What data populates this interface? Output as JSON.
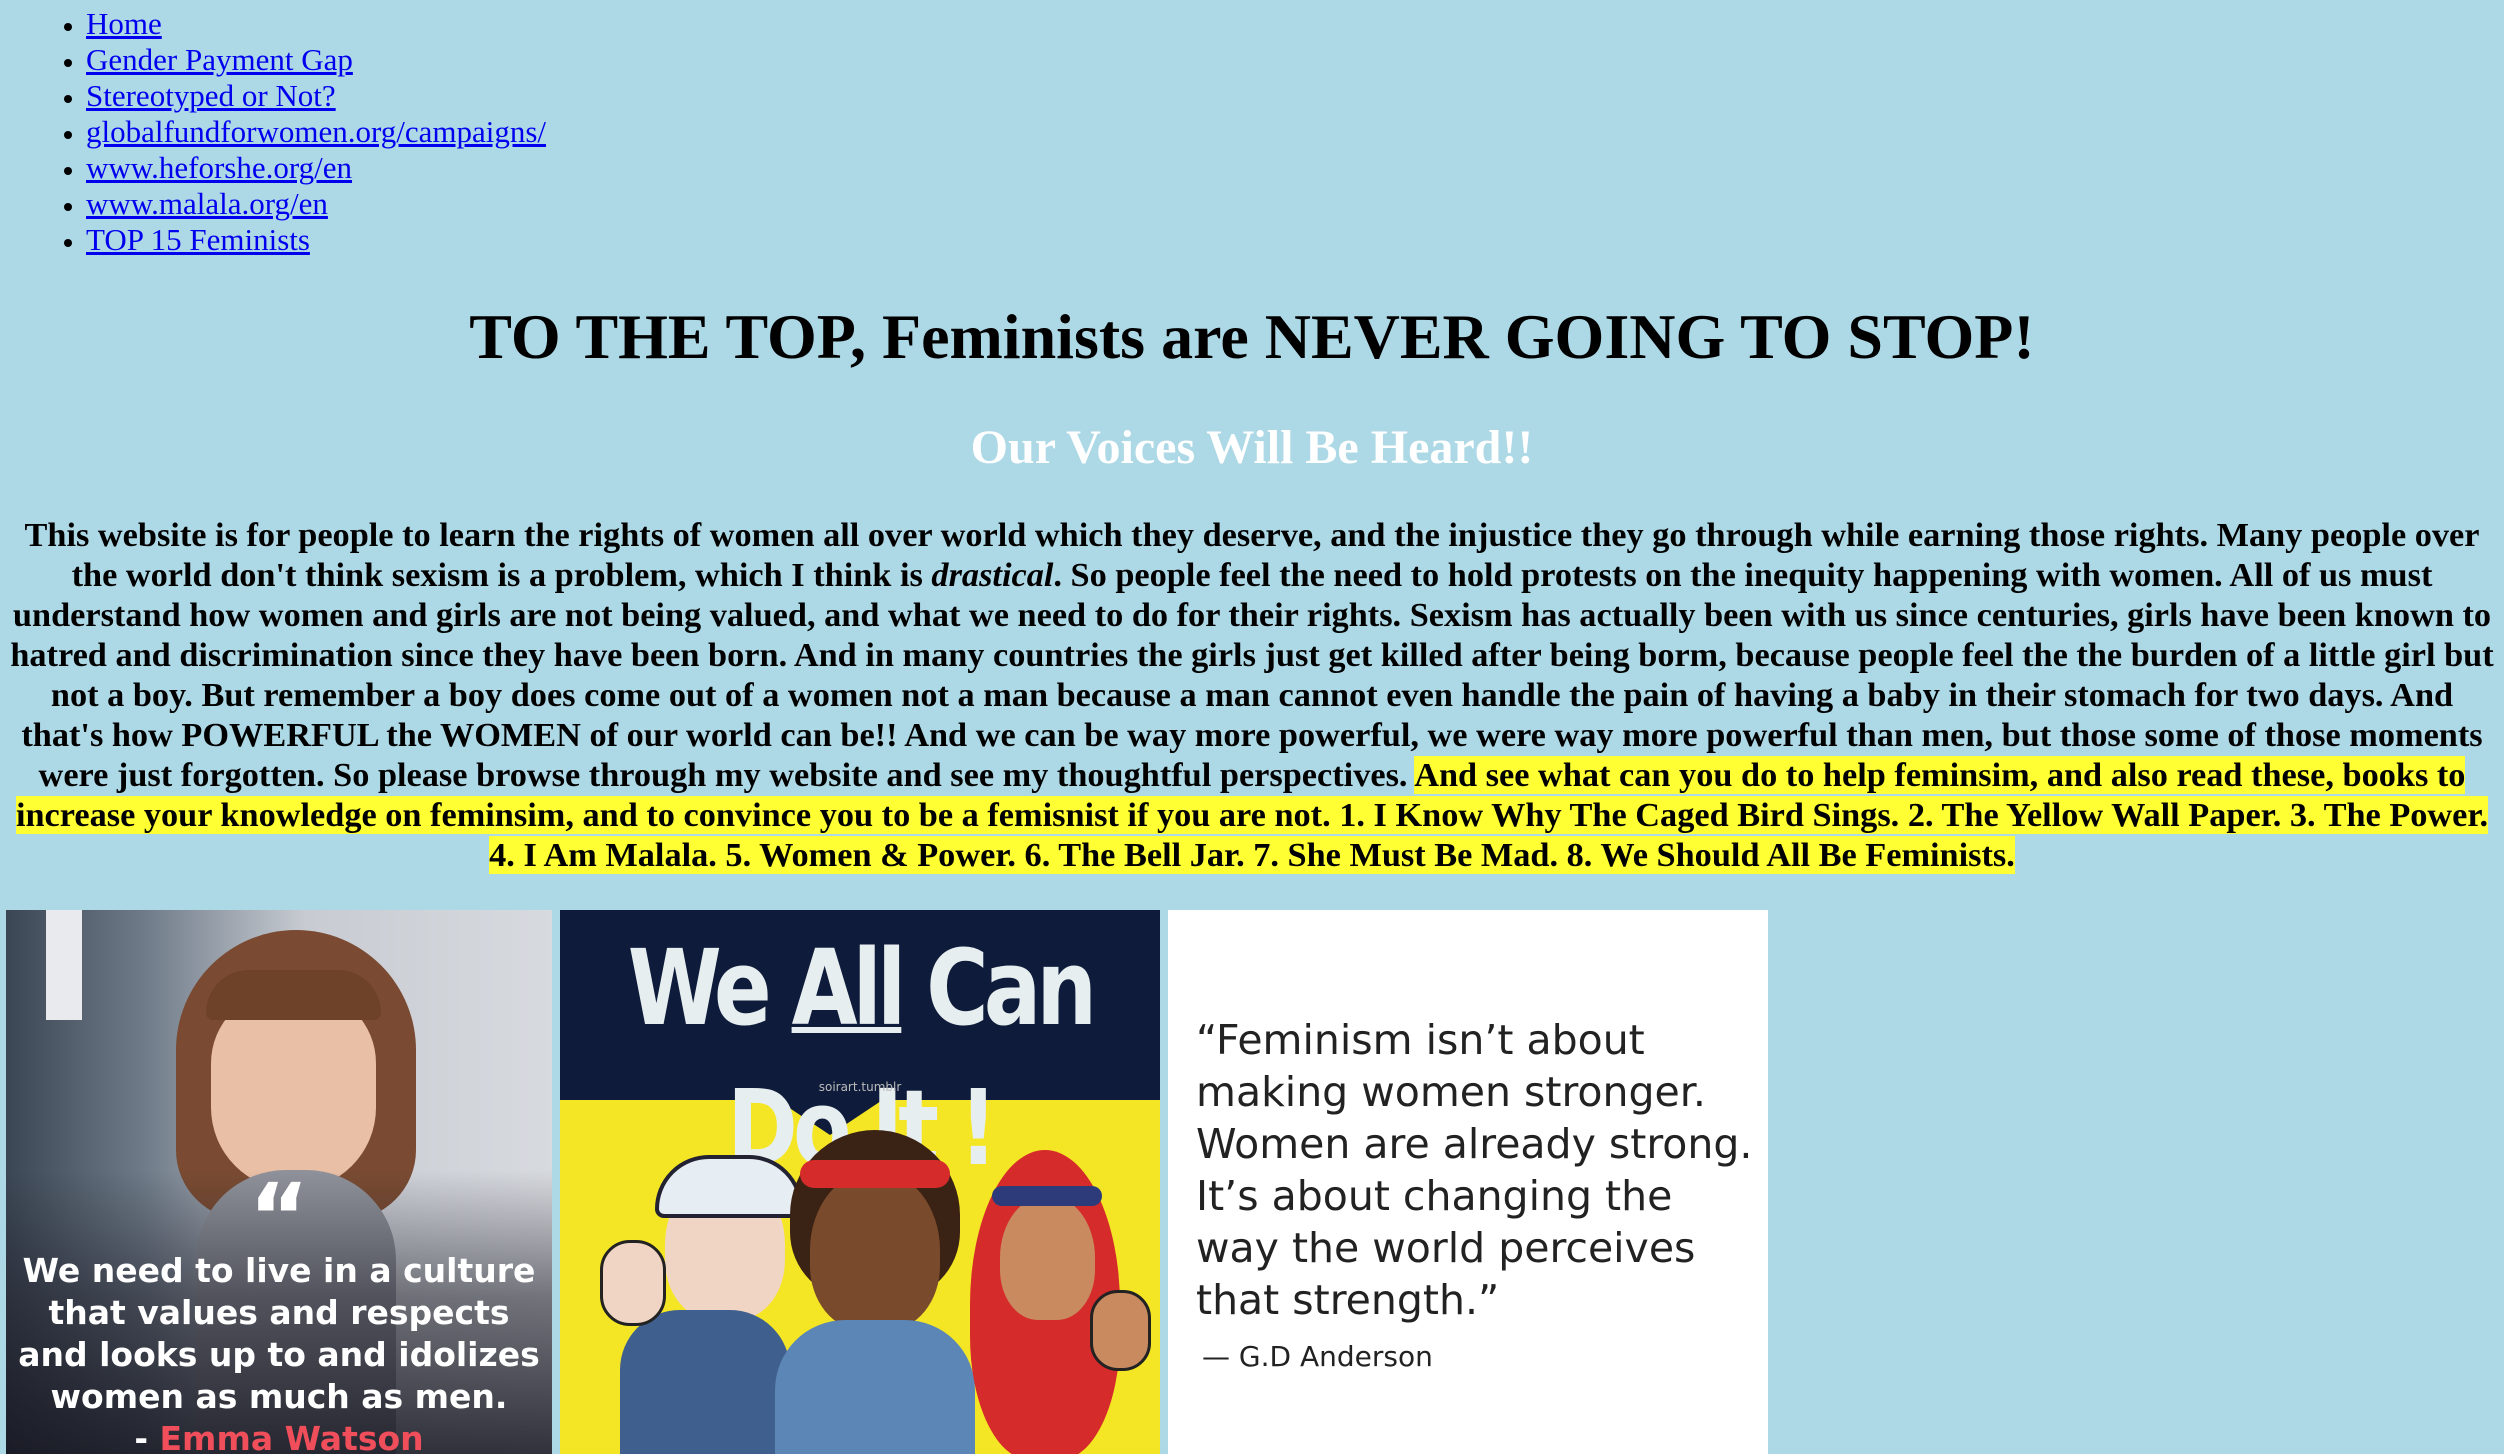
{
  "nav": {
    "items": [
      "Home",
      "Gender Payment Gap",
      "Stereotyped or Not?",
      "globalfundforwomen.org/campaigns/",
      "www.heforshe.org/en",
      "www.malala.org/en",
      "TOP 15 Feminists"
    ]
  },
  "heading": "TO THE TOP, Feminists are NEVER GOING TO STOP!",
  "subheading": "Our Voices Will Be Heard!!",
  "paragraph": {
    "part1": "This website is for people to learn the rights of women all over world which they deserve, and the injustice they go through while earning those rights. Many people over the world don't think sexism is a problem, which I think is ",
    "emphasis": "drastical",
    "part2": ". So people feel the need to hold protests on the inequity happening with women. All of us must understand how women and girls are not being valued, and what we need to do for their rights. Sexism has actually been with us since centuries, girls have been known to hatred and discrimination since they have been born. And in many countries the girls just get killed after being borm, because people feel the the burden of a little girl but not a boy. But remember a boy does come out of a women not a man because a man cannot even handle the pain of having a baby in their stomach for two days. And that's how POWERFUL the WOMEN of our world can be!! And we can be way more powerful, we were way more powerful than men, but those some of those moments were just forgotten. So please browse through my website and see my thoughtful perspectives. ",
    "highlight": "And see what can you do to help feminsim, and also read these, books to increase your knowledge on feminsim, and to convince you to be a femisnist if you are not. 1. I Know Why The Caged Bird Sings. 2. The Yellow Wall Paper. 3. The Power. 4. I Am Malala. 5. Women & Power. 6. The Bell Jar. 7. She Must Be Mad. 8. We Should All Be Feminists."
  },
  "images": {
    "img1": {
      "quote": "We need to live in a culture that values and respects and looks up to and idolizes women as much as men.",
      "author_prefix": "- ",
      "author": "Emma Watson",
      "author_color": "#f04e5b"
    },
    "img2": {
      "title_pre": "We ",
      "title_u": "All",
      "title_post": " Can Do It !",
      "tag": "soirart.tumblr"
    },
    "img3": {
      "quote": "“Feminism isn’t about making women stronger. Women are already strong. It’s about changing the way the world perceives that strength.”",
      "author": "— G.D Anderson"
    }
  },
  "colors": {
    "background": "#add8e6",
    "link": "#0000ee",
    "highlight": "#ffff33",
    "subheading": "#ffffff"
  }
}
